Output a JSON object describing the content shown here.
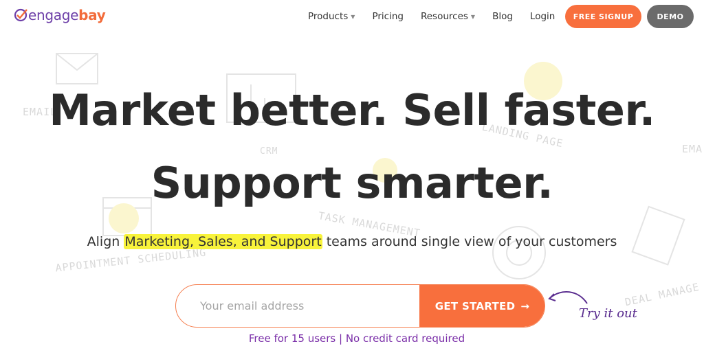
{
  "brand": {
    "logo_part1": "engage",
    "logo_part2": "bay",
    "color_primary": "#f86f3d",
    "color_secondary": "#6d3fa8"
  },
  "nav": {
    "items": [
      {
        "label": "Products",
        "has_dropdown": true
      },
      {
        "label": "Pricing",
        "has_dropdown": false
      },
      {
        "label": "Resources",
        "has_dropdown": true
      },
      {
        "label": "Blog",
        "has_dropdown": false
      },
      {
        "label": "Login",
        "has_dropdown": false
      }
    ],
    "signup_label": "FREE SIGNUP",
    "demo_label": "DEMO"
  },
  "background_labels": [
    "EMAIL",
    "CRM",
    "LANDING PAGE",
    "EMA",
    "TASK MANAGEMENT",
    "APPOINTMENT SCHEDULING",
    "DEAL MANAGE"
  ],
  "hero": {
    "headline_line1": "Market better. Sell faster.",
    "headline_line2": "Support smarter.",
    "sub_prefix": "Align ",
    "sub_highlight": "Marketing, Sales, and Support",
    "sub_suffix": " teams around single view of your customers",
    "email_placeholder": "Your email address",
    "email_value": "",
    "cta_label": "GET STARTED",
    "cta_arrow": "→",
    "try_label": "Try it out",
    "note": "Free for 15 users | No credit card required"
  }
}
